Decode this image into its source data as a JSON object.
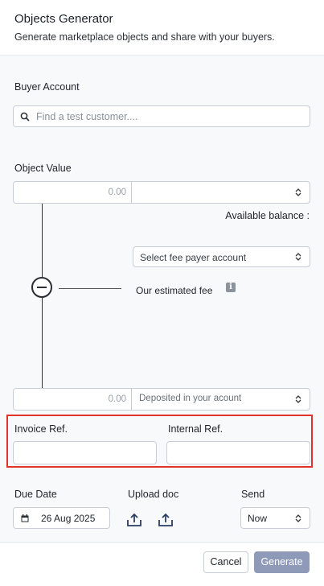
{
  "header": {
    "title": "Objects Generator",
    "subtitle": "Generate marketplace objects and share with your buyers."
  },
  "buyer": {
    "label": "Buyer Account",
    "search_placeholder": "Find a test customer...."
  },
  "object_value": {
    "label": "Object Value",
    "amount": "0.00",
    "currency_value": "",
    "available_balance_label": "Available balance :"
  },
  "fee": {
    "payer_select": "Select fee payer account",
    "estimated_label": "Our estimated fee"
  },
  "deposit": {
    "amount": "0.00",
    "select_label": "Deposited in your acount"
  },
  "refs": {
    "invoice_label": "Invoice Ref.",
    "invoice_value": "",
    "internal_label": "Internal Ref.",
    "internal_value": ""
  },
  "due_date": {
    "label": "Due Date",
    "value": "26 Aug 2025"
  },
  "upload": {
    "label": "Upload doc"
  },
  "send": {
    "label": "Send",
    "value": "Now"
  },
  "footer": {
    "cancel_label": "Cancel",
    "generate_label": "Generate"
  },
  "colors": {
    "highlight_border": "#e0332b",
    "generate_button": "#8e9ab8",
    "text_primary": "#1f2329"
  }
}
